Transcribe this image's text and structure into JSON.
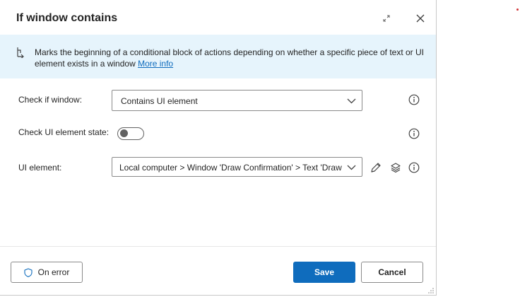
{
  "dialog": {
    "title": "If window contains",
    "banner": {
      "text": "Marks the beginning of a conditional block of actions depending on whether a specific piece of text or UI element exists in a window",
      "link": "More info"
    },
    "fields": {
      "check_if_window": {
        "label": "Check if window:",
        "value": "Contains UI element"
      },
      "check_ui_element_state": {
        "label": "Check UI element state:",
        "value": false
      },
      "ui_element": {
        "label": "UI element:",
        "value": "Local computer > Window 'Draw Confirmation' > Text 'Draw"
      }
    },
    "footer": {
      "on_error": "On error",
      "save": "Save",
      "cancel": "Cancel"
    }
  },
  "colors": {
    "accent": "#0f6cbd",
    "banner_bg": "#e6f4fc"
  },
  "icons": {
    "banner": "branch-icon",
    "expand": "expand-icon",
    "close": "close-icon",
    "info": "info-icon",
    "chevron": "chevron-down-icon",
    "edit": "pencil-icon",
    "layers": "layers-icon",
    "shield": "shield-icon"
  }
}
